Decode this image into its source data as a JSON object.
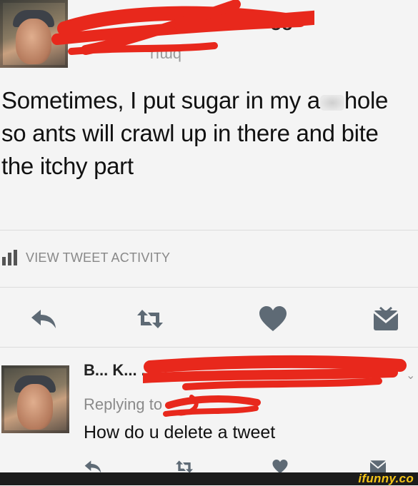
{
  "tweet": {
    "text_before": "Sometimes, I put sugar in my a",
    "text_after": "hole so ants will crawl up in there and bite the itchy part",
    "header_fragment": "ᴗᴗ",
    "handle_fragment": "ɾıɯq"
  },
  "activity": {
    "label": "VIEW TWEET ACTIVITY",
    "icon": "bar-chart-icon"
  },
  "actions": {
    "icons": [
      "reply-icon",
      "retweet-icon",
      "like-icon",
      "message-icon"
    ],
    "accent": "#5e6a75"
  },
  "reply": {
    "name_fragment": "B... K... ...",
    "replying_label": "Replying to",
    "text": "How do u delete a tweet"
  },
  "scribble_color": "#e8281c",
  "watermark": "ifunny.co"
}
